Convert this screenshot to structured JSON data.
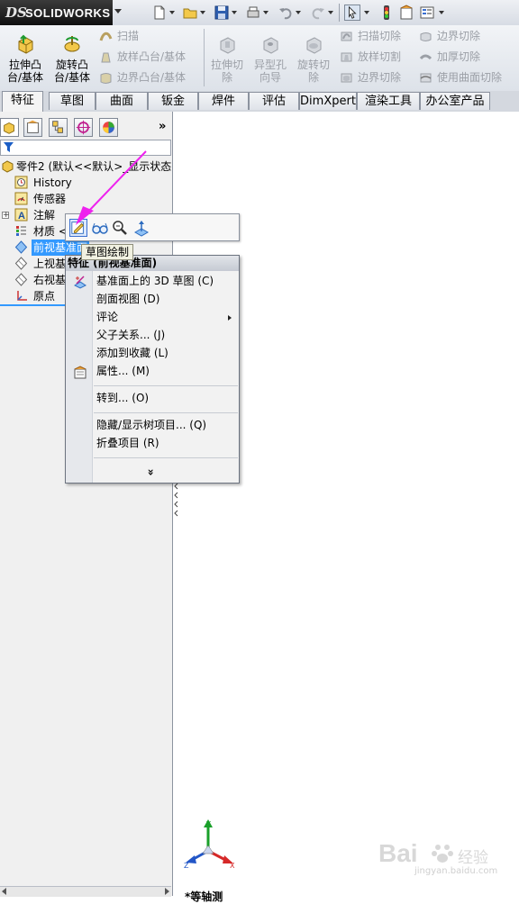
{
  "app": {
    "logo_ds": "DS",
    "logo_name": "SOLIDWORKS"
  },
  "command_manager": {
    "big_buttons": [
      {
        "label_line1": "拉伸凸",
        "label_line2": "台/基体",
        "enabled": true
      },
      {
        "label_line1": "旋转凸",
        "label_line2": "台/基体",
        "enabled": true
      },
      {
        "label_line1": "拉伸切",
        "label_line2": "除",
        "enabled": false
      },
      {
        "label_line1": "异型孔",
        "label_line2": "向导",
        "enabled": false
      },
      {
        "label_line1": "旋转切",
        "label_line2": "除",
        "enabled": false
      }
    ],
    "small_buttons_col1": [
      "扫描",
      "放样凸台/基体",
      "边界凸台/基体"
    ],
    "small_buttons_col2": [
      "扫描切除",
      "放样切割",
      "边界切除"
    ],
    "small_buttons_col3": [
      "边界切除",
      "加厚切除",
      "使用曲面切除"
    ]
  },
  "tabs": [
    "特征",
    "草图",
    "曲面",
    "钣金",
    "焊件",
    "评估",
    "DimXpert",
    "渲染工具",
    "办公室产品"
  ],
  "feature_tree": {
    "root": "零件2 (默认<<默认>_显示状态",
    "items": [
      {
        "label": "History",
        "icon": "history-icon"
      },
      {
        "label": "传感器",
        "icon": "sensor-icon"
      },
      {
        "label": "注解",
        "icon": "annotation-icon"
      },
      {
        "label": "材质 <",
        "icon": "material-icon"
      },
      {
        "label": "前视基准面",
        "icon": "plane-icon"
      },
      {
        "label": "上视基",
        "icon": "plane-icon"
      },
      {
        "label": "右视基",
        "icon": "plane-icon"
      },
      {
        "label": "原点",
        "icon": "origin-icon"
      }
    ]
  },
  "context_toolbar": {
    "tooltip": "草图绘制"
  },
  "context_menu": {
    "title": "特征 (前视基准面)",
    "items": [
      "基准面上的 3D 草图 (C)",
      "剖面视图 (D)",
      "评论",
      "父子关系... (J)",
      "添加到收藏 (L)",
      "属性... (M)",
      "转到... (O)",
      "隐藏/显示树项目... (Q)",
      "折叠项目 (R)"
    ],
    "more": "»"
  },
  "graphics": {
    "axis_y": "Y",
    "axis_x": "X",
    "axis_z": "Z",
    "bottom_text": "*等轴测",
    "watermark_main": "Bai",
    "watermark_brand": "经验",
    "watermark_url": "jingyan.baidu.com"
  },
  "colors": {
    "selection": "#3399ff",
    "annotation_arrow": "#ee22ee",
    "title_bar": "#1a1a1a"
  }
}
